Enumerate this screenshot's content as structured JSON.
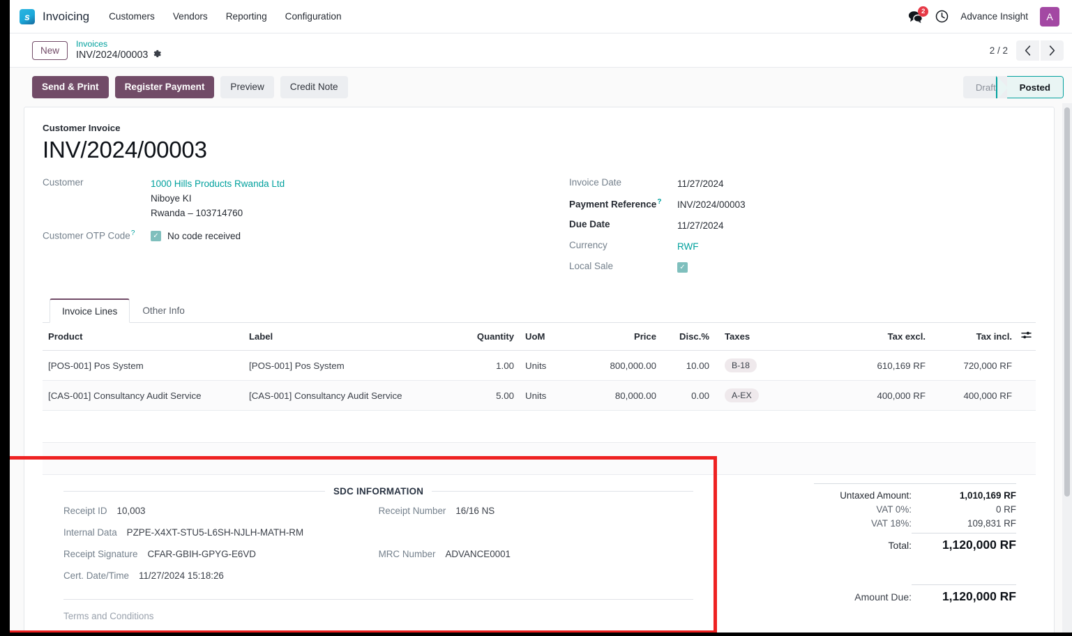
{
  "navbar": {
    "brand_glyph": "s",
    "brand_name": "Invoicing",
    "menu": [
      {
        "label": "Customers"
      },
      {
        "label": "Vendors"
      },
      {
        "label": "Reporting"
      },
      {
        "label": "Configuration"
      }
    ],
    "messages_icon": "chat-bubbles-icon",
    "messages_count": "2",
    "activity_icon": "clock-icon",
    "user_name": "Advance Insight",
    "avatar_initial": "A"
  },
  "breadcrumb": {
    "new_button": "New",
    "parent": "Invoices",
    "current": "INV/2024/00003",
    "settings_icon": "gear-icon",
    "pager_count": "2 / 2",
    "prev_icon": "chevron-left-icon",
    "next_icon": "chevron-right-icon"
  },
  "actions": {
    "send_print": "Send & Print",
    "register_payment": "Register Payment",
    "preview": "Preview",
    "credit_note": "Credit Note"
  },
  "status": {
    "draft": "Draft",
    "posted": "Posted",
    "active": "Posted",
    "accent": "#00A09D"
  },
  "document": {
    "type_label": "Customer Invoice",
    "title": "INV/2024/00003"
  },
  "left_fields": {
    "customer_label": "Customer",
    "customer_name": "1000 Hills Products Rwanda Ltd",
    "customer_address_line1": "Niboye KI",
    "customer_address_line2": "Rwanda – 103714760",
    "otp_label": "Customer OTP Code",
    "otp_help": "?",
    "otp_checked": true,
    "otp_text": "No code received"
  },
  "right_fields": {
    "invoice_date_label": "Invoice Date",
    "invoice_date": "11/27/2024",
    "payment_reference_label": "Payment Reference",
    "payment_reference_help": "?",
    "payment_reference": "INV/2024/00003",
    "due_date_label": "Due Date",
    "due_date": "11/27/2024",
    "currency_label": "Currency",
    "currency": "RWF",
    "local_sale_label": "Local Sale",
    "local_sale_checked": true
  },
  "notebook": {
    "tabs": [
      {
        "label": "Invoice Lines",
        "active": true
      },
      {
        "label": "Other Info",
        "active": false
      }
    ]
  },
  "lines_table": {
    "columns": [
      "Product",
      "Label",
      "Quantity",
      "UoM",
      "Price",
      "Disc.%",
      "Taxes",
      "Tax excl.",
      "Tax incl."
    ],
    "options_icon": "table-options-icon",
    "rows": [
      {
        "product": "[POS-001] Pos System",
        "label": "[POS-001] Pos System",
        "quantity": "1.00",
        "uom": "Units",
        "price": "800,000.00",
        "discount": "10.00",
        "taxes": "B-18",
        "tax_excl": "610,169 RF",
        "tax_incl": "720,000 RF"
      },
      {
        "product": "[CAS-001] Consultancy Audit Service",
        "label": "[CAS-001] Consultancy Audit Service",
        "quantity": "5.00",
        "uom": "Units",
        "price": "80,000.00",
        "discount": "0.00",
        "taxes": "A-EX",
        "tax_excl": "400,000 RF",
        "tax_incl": "400,000 RF"
      }
    ]
  },
  "sdc": {
    "section_title": "SDC INFORMATION",
    "receipt_id_label": "Receipt ID",
    "receipt_id": "10,003",
    "internal_data_label": "Internal Data",
    "internal_data": "PZPE-X4XT-STU5-L6SH-NJLH-MATH-RM",
    "receipt_signature_label": "Receipt Signature",
    "receipt_signature": "CFAR-GBIH-GPYG-E6VD",
    "cert_datetime_label": "Cert. Date/Time",
    "cert_datetime": "11/27/2024 15:18:26",
    "receipt_number_label": "Receipt Number",
    "receipt_number": "16/16 NS",
    "mrc_number_label": "MRC Number",
    "mrc_number": "ADVANCE0001",
    "terms_label": "Terms and Conditions"
  },
  "totals": {
    "untaxed_label": "Untaxed Amount:",
    "untaxed_value": "1,010,169 RF",
    "vat0_label": "VAT 0%:",
    "vat0_value": "0 RF",
    "vat18_label": "VAT 18%:",
    "vat18_value": "109,831 RF",
    "total_label": "Total:",
    "total_value": "1,120,000 RF",
    "amount_due_label": "Amount Due:",
    "amount_due_value": "1,120,000 RF"
  }
}
